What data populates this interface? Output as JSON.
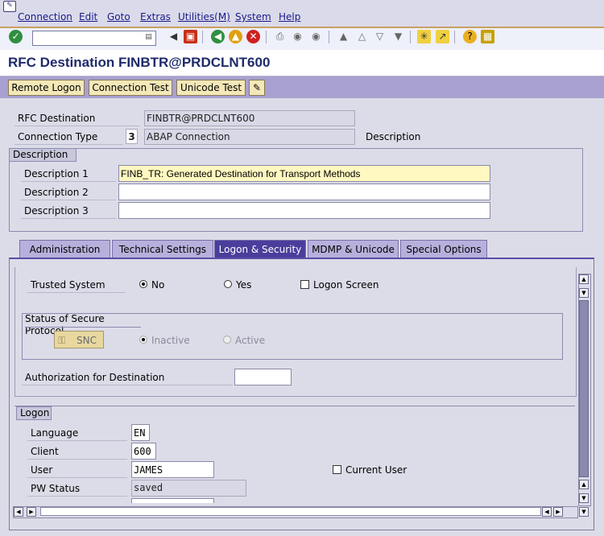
{
  "menu": [
    "Connection",
    "Edit",
    "Goto",
    "Extras",
    "Utilities(M)",
    "System",
    "Help"
  ],
  "toolbar": {
    "command_field_value": "",
    "icons": [
      "enter-icon",
      "back-icon",
      "save-icon",
      "back-nav-icon",
      "exit-icon",
      "cancel-icon",
      "print-icon",
      "find-icon",
      "find-next-icon",
      "first-page-icon",
      "previous-page-icon",
      "next-page-icon",
      "last-page-icon",
      "new-session-icon",
      "shortcut-icon",
      "help-icon",
      "layout-menu-icon"
    ]
  },
  "title": "RFC Destination FINBTR@PRDCLNT600",
  "app_buttons": [
    "Remote Logon",
    "Connection Test",
    "Unicode Test"
  ],
  "header": {
    "rfc_destination_label": "RFC Destination",
    "rfc_destination_value": "FINBTR@PRDCLNT600",
    "connection_type_label": "Connection Type",
    "connection_type_code": "3",
    "connection_type_value": "ABAP Connection",
    "description_label": "Description"
  },
  "description_group": {
    "title": "Description",
    "rows": [
      {
        "label": "Description 1",
        "value": "FINB_TR: Generated Destination for Transport Methods"
      },
      {
        "label": "Description 2",
        "value": ""
      },
      {
        "label": "Description 3",
        "value": ""
      }
    ]
  },
  "tabs": [
    "Administration",
    "Technical Settings",
    "Logon & Security",
    "MDMP & Unicode",
    "Special Options"
  ],
  "active_tab": "Logon & Security",
  "security": {
    "trusted_system_label": "Trusted System",
    "trusted_no": "No",
    "trusted_yes": "Yes",
    "trusted_selected": "No",
    "logon_screen_label": "Logon Screen",
    "secure_protocol_title": "Status of Secure Protocol",
    "snc_button": "SNC",
    "inactive_label": "Inactive",
    "active_label": "Active",
    "auth_label": "Authorization for Destination",
    "auth_value": ""
  },
  "logon": {
    "title": "Logon",
    "language_label": "Language",
    "language_value": "EN",
    "client_label": "Client",
    "client_value": "600",
    "user_label": "User",
    "user_value": "JAMES",
    "current_user_label": "Current User",
    "pw_status_label": "PW Status",
    "pw_status_value": "saved"
  },
  "colors": {
    "title_text": "#1f2a6b",
    "app_toolbar": "#a8a0d0",
    "app_button": "#f4e8b8",
    "active_tab": "#4a3e9c",
    "tab": "#b8b0dc",
    "highlight_field": "#fff8c0"
  }
}
